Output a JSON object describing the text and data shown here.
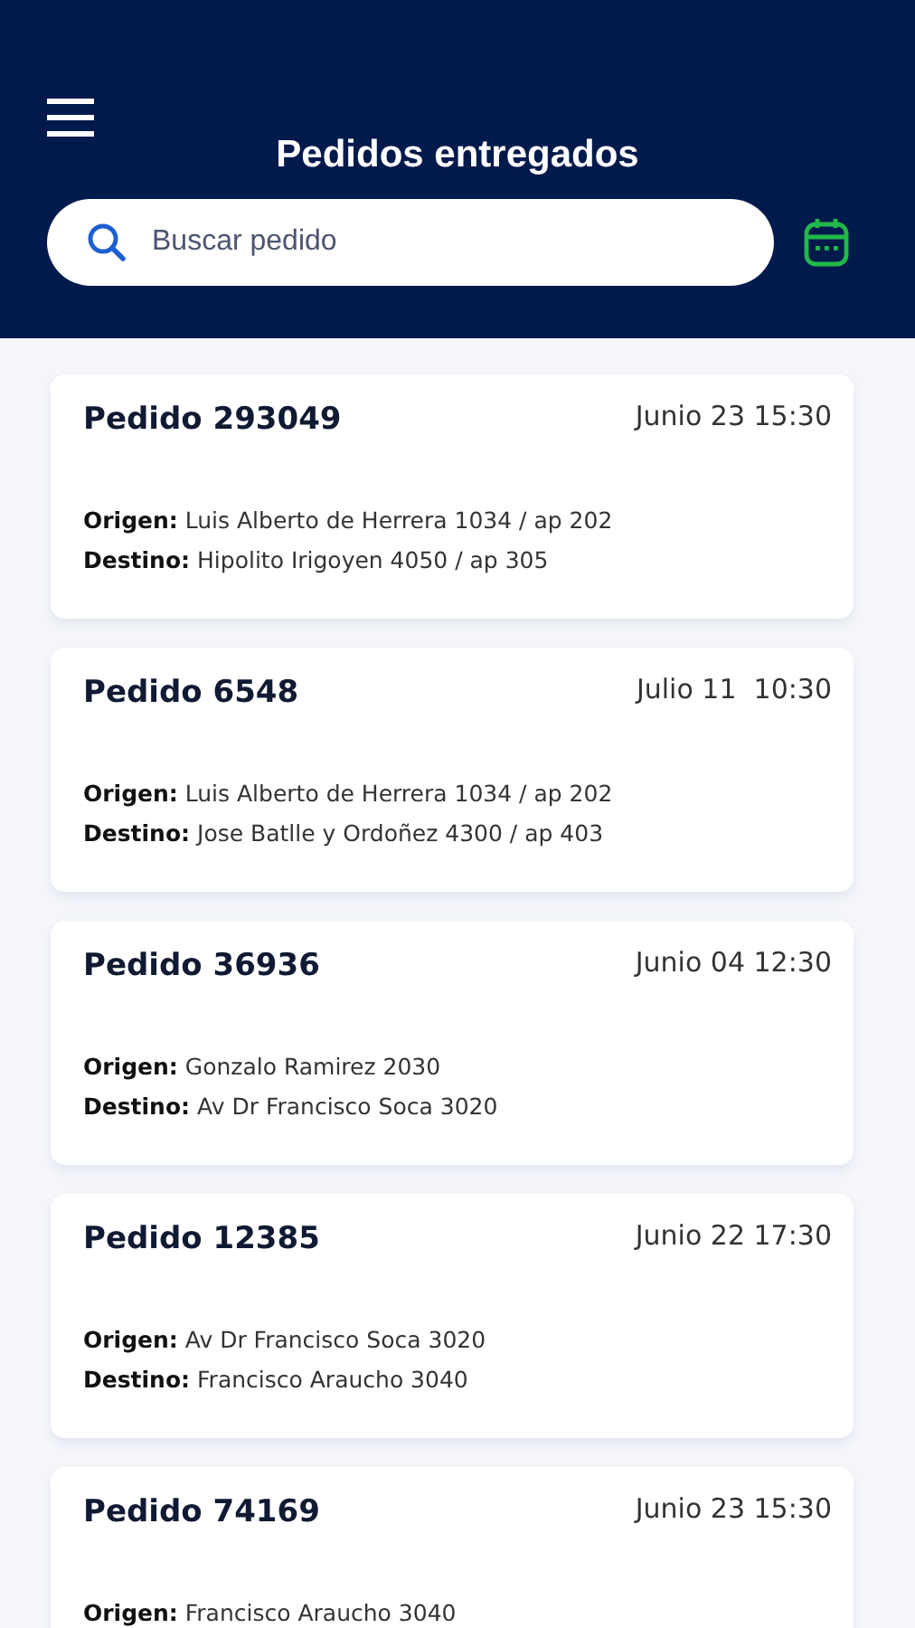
{
  "header": {
    "title": "Pedidos entregados"
  },
  "search": {
    "placeholder": "Buscar pedido"
  },
  "orders": [
    {
      "title": "Pedido 293049",
      "date": "Junio 23 15:30",
      "origin": "**Origen:** Luis Alberto de Herrera 1034 / ap 202",
      "destination": "**Destino:** Hipolito Irigoyen 4050 / ap 305"
    },
    {
      "title": "Pedido 6548",
      "date": "Julio 11  10:30",
      "origin": "**Origen:** Luis Alberto de Herrera 1034 / ap 202",
      "destination": "**Destino:** Jose Batlle y Ordoñez 4300 / ap 403"
    },
    {
      "title": "Pedido 36936",
      "date": "Junio 04 12:30",
      "origin": "**Origen:** Gonzalo Ramirez 2030",
      "destination": "**Destino:** Av Dr Francisco Soca 3020"
    },
    {
      "title": "Pedido 12385",
      "date": "Junio 22 17:30",
      "origin": "**Origen:** Av Dr Francisco Soca 3020",
      "destination": "**Destino:** Francisco Araucho 3040"
    },
    {
      "title": "Pedido 74169",
      "date": "Junio 23 15:30",
      "origin": "**Origen:** Francisco Araucho 3040"
    }
  ]
}
